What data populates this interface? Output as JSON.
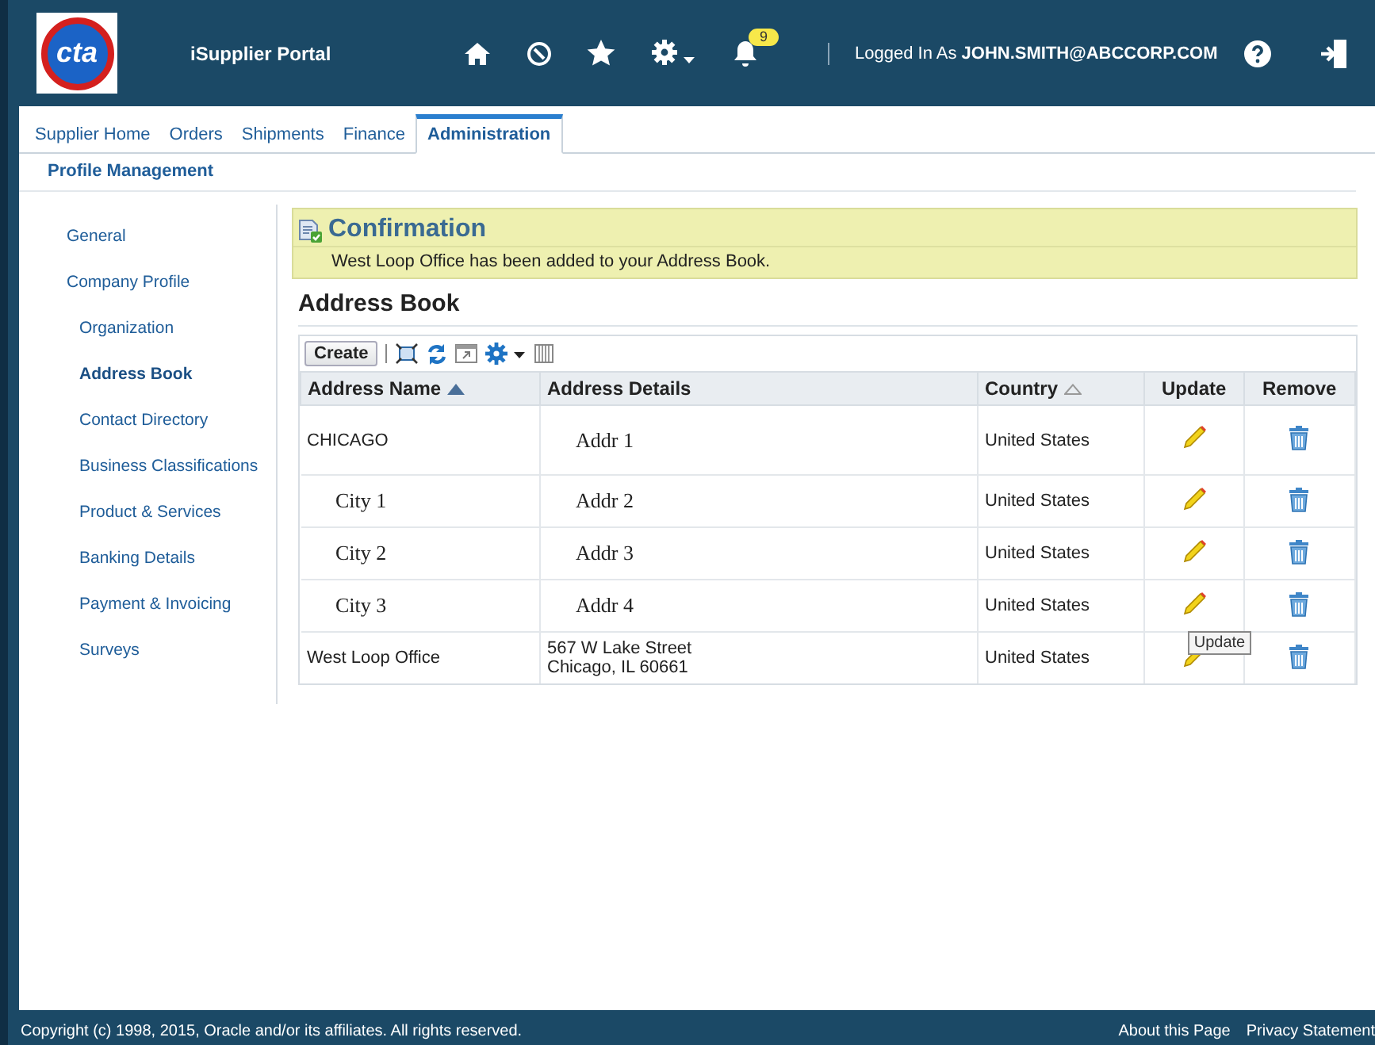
{
  "header": {
    "logo": "cta",
    "title": "iSupplier Portal",
    "notifications": "9",
    "user_prefix": "Logged In As",
    "user": "JOHN.SMITH@ABCCORP.COM"
  },
  "tabs": [
    {
      "label": "Supplier Home",
      "selected": false
    },
    {
      "label": "Orders",
      "selected": false
    },
    {
      "label": "Shipments",
      "selected": false
    },
    {
      "label": "Finance",
      "selected": false
    },
    {
      "label": "Administration",
      "selected": true
    }
  ],
  "subtab": "Profile Management",
  "sidebar": {
    "items": [
      {
        "label": "General",
        "selected": false
      },
      {
        "label": "Company Profile",
        "selected": false,
        "children": [
          {
            "label": "Organization",
            "selected": false
          },
          {
            "label": "Address Book",
            "selected": true
          },
          {
            "label": "Contact Directory",
            "selected": false
          },
          {
            "label": "Business Classifications",
            "selected": false
          },
          {
            "label": "Product & Services",
            "selected": false
          },
          {
            "label": "Banking Details",
            "selected": false
          },
          {
            "label": "Payment & Invoicing",
            "selected": false
          },
          {
            "label": "Surveys",
            "selected": false
          }
        ]
      }
    ]
  },
  "confirmation": {
    "title": "Confirmation",
    "message": "West Loop Office has been added to your Address Book."
  },
  "page_title": "Address Book",
  "toolbar": {
    "create": "Create"
  },
  "table": {
    "columns": [
      {
        "label": "Address Name",
        "kind": "sorted"
      },
      {
        "label": "Address Details",
        "kind": "plain"
      },
      {
        "label": "Country",
        "kind": "sortable"
      },
      {
        "label": "Update",
        "kind": "plain"
      },
      {
        "label": "Remove",
        "kind": "plain"
      }
    ],
    "rows": [
      {
        "name": "CHICAGO",
        "name_edited": false,
        "details": [
          "Addr 1"
        ],
        "details_edited": true,
        "country": "United States"
      },
      {
        "name": "City 1",
        "name_edited": true,
        "details": [
          "Addr 2"
        ],
        "details_edited": true,
        "country": "United States"
      },
      {
        "name": "City 2",
        "name_edited": true,
        "details": [
          "Addr 3"
        ],
        "details_edited": true,
        "country": "United States"
      },
      {
        "name": "City 3",
        "name_edited": true,
        "details": [
          "Addr 4"
        ],
        "details_edited": true,
        "country": "United States"
      },
      {
        "name": "West Loop Office",
        "name_edited": false,
        "details": [
          "567 W Lake Street",
          "Chicago, IL 60661"
        ],
        "details_edited": false,
        "country": "United States",
        "tooltip": "Update"
      }
    ]
  },
  "footer": {
    "copyright": "Copyright (c) 1998, 2015, Oracle and/or its affiliates. All rights reserved.",
    "links": [
      "About this Page",
      "Privacy Statement"
    ]
  }
}
